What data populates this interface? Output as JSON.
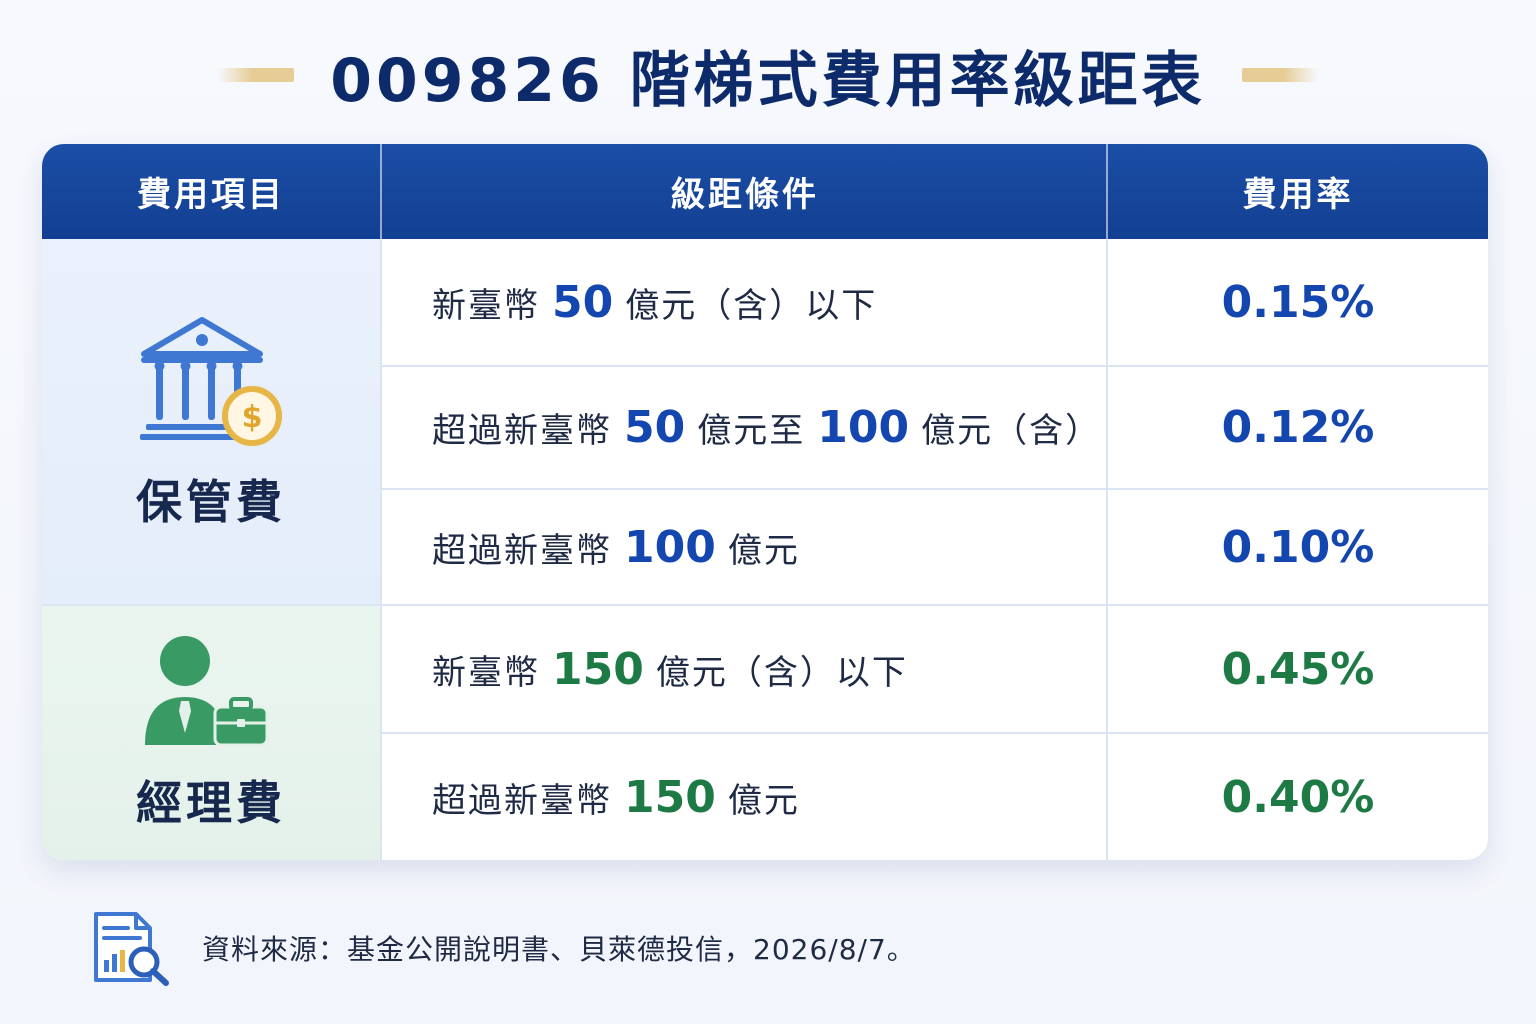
{
  "title": "009826 階梯式費用率級距表",
  "table": {
    "headers": [
      "費用項目",
      "級距條件",
      "費用率"
    ],
    "categories": [
      {
        "name": "保管費",
        "icon": "bank-dollar-icon",
        "rows": [
          {
            "prefix": "新臺幣",
            "num1": "50",
            "mid": "億元（含）以下",
            "num2": "",
            "suffix": "",
            "rate": "0.15%"
          },
          {
            "prefix": "超過新臺幣",
            "num1": "50",
            "mid": "億元至",
            "num2": "100",
            "suffix": "億元（含）",
            "rate": "0.12%"
          },
          {
            "prefix": "超過新臺幣",
            "num1": "100",
            "mid": "億元",
            "num2": "",
            "suffix": "",
            "rate": "0.10%"
          }
        ]
      },
      {
        "name": "經理費",
        "icon": "manager-briefcase-icon",
        "rows": [
          {
            "prefix": "新臺幣",
            "num1": "150",
            "mid": "億元（含）以下",
            "num2": "",
            "suffix": "",
            "rate": "0.45%"
          },
          {
            "prefix": "超過新臺幣",
            "num1": "150",
            "mid": "億元",
            "num2": "",
            "suffix": "",
            "rate": "0.40%"
          }
        ]
      }
    ]
  },
  "footer": {
    "source": "資料來源：基金公開說明書、貝萊德投信，2026/8/7。",
    "icon": "report-search-icon"
  },
  "colors": {
    "header_bg": "#123f92",
    "title": "#0d2b6b",
    "accent_blue": "#1446b0",
    "accent_green": "#1e7a45",
    "gold": "#e6cd96",
    "custody_bg": "#e4edfa",
    "management_bg": "#e4f1ea"
  }
}
